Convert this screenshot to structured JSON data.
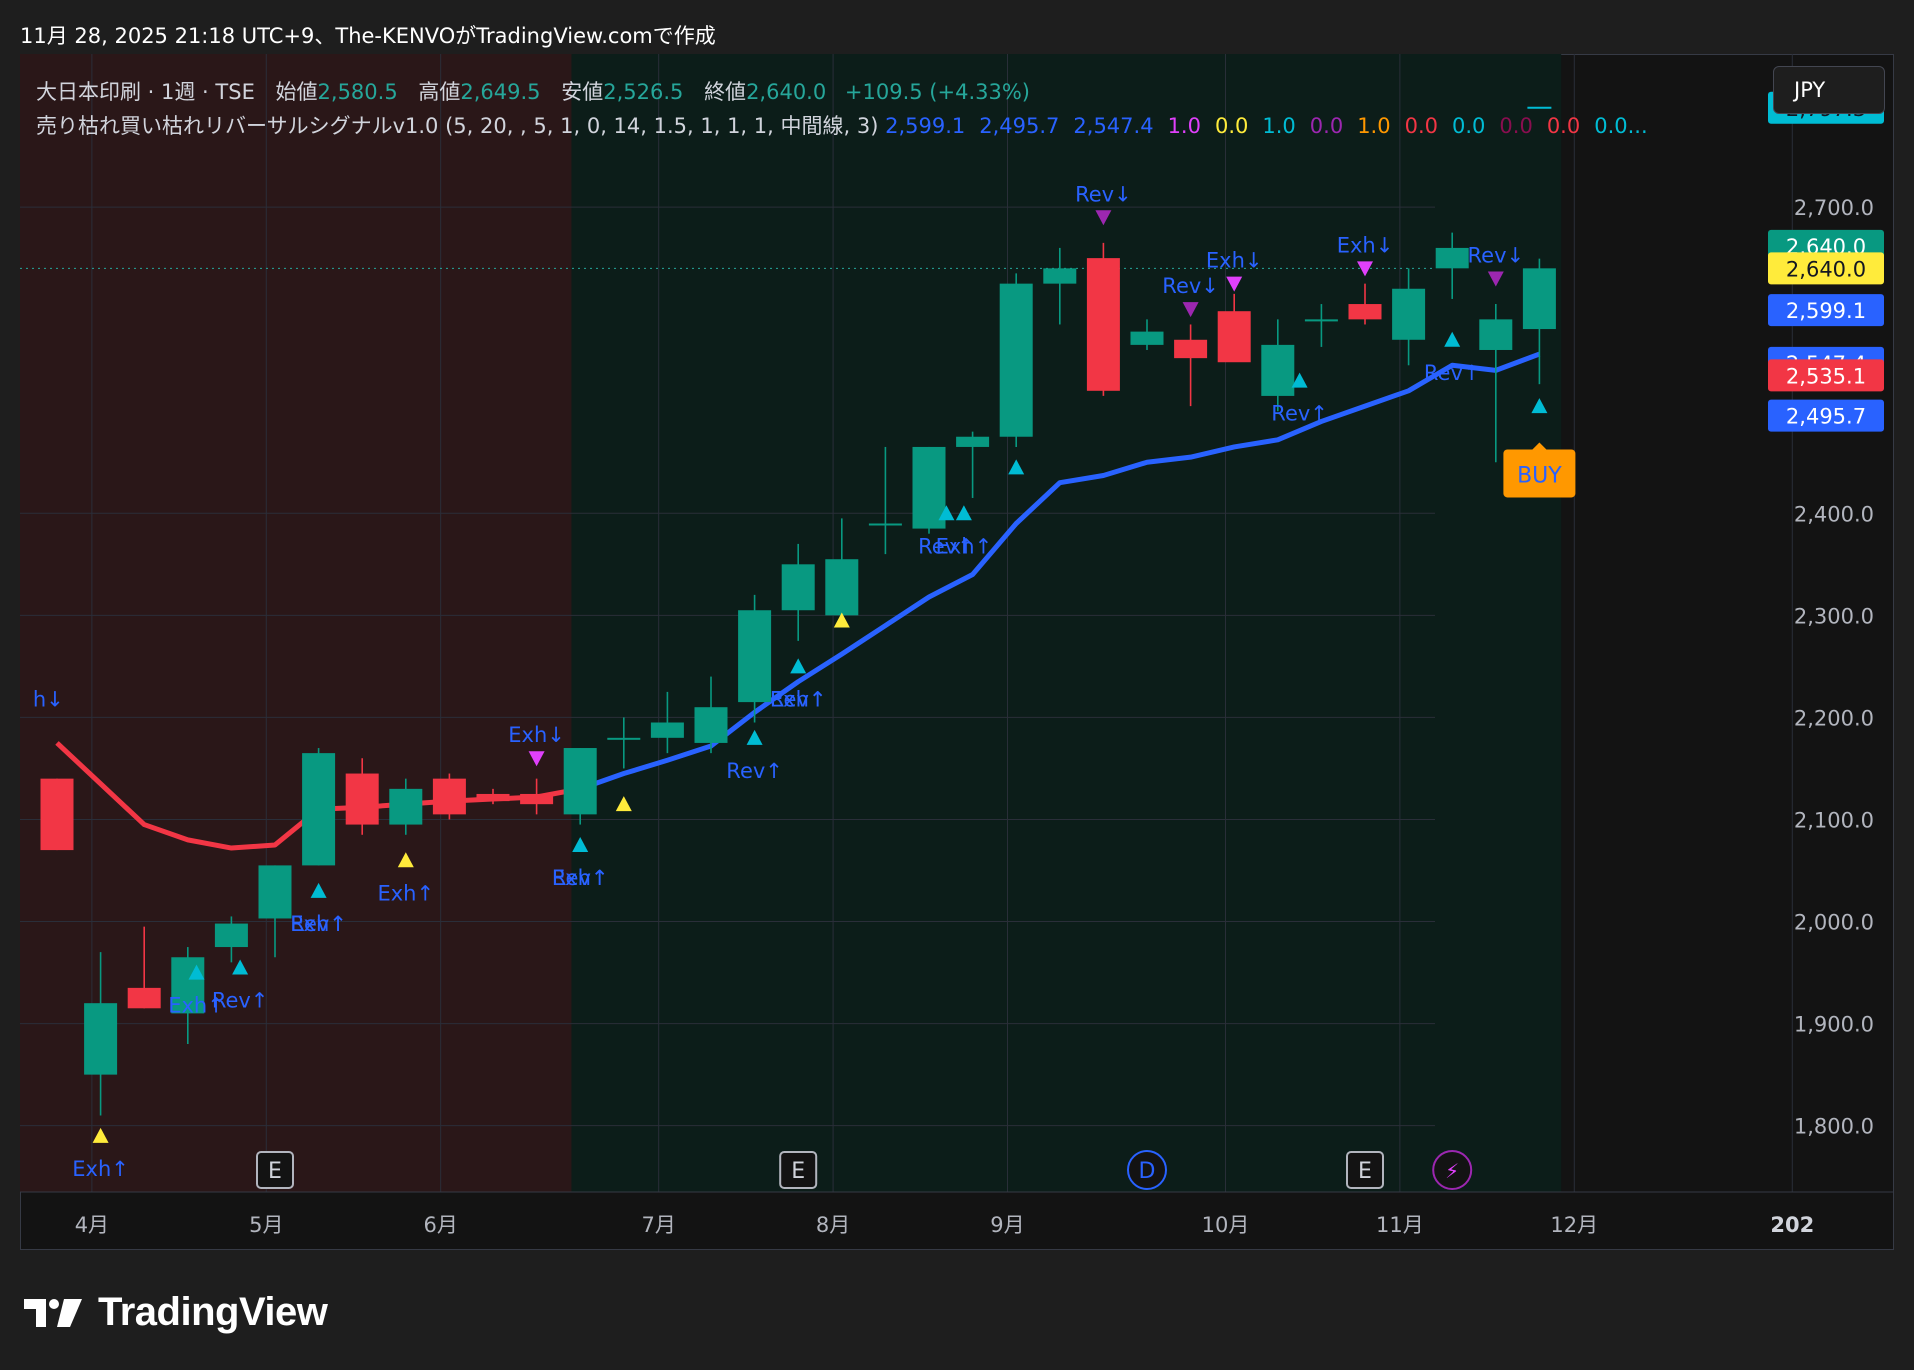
{
  "caption": "11月 28, 2025 21:18 UTC+9、The-KENVOがTradingView.comで作成",
  "currency": "JPY",
  "brand": "TradingView",
  "legend": {
    "symbol": "大日本印刷 · 1週 · TSE",
    "open_label": "始値",
    "open": "2,580.5",
    "high_label": "高値",
    "high": "2,649.5",
    "low_label": "安値",
    "low": "2,526.5",
    "close_label": "終値",
    "close": "2,640.0",
    "change": "+109.5 (+4.33%)"
  },
  "indicator": {
    "title": "売り枯れ買い枯れリバーサルシグナルv1.0 (5, 20, , 5, 1, 0, 14, 1.5, 1, 1, 1, 中間線, 3)",
    "values": [
      {
        "text": "2,599.1",
        "color": "#2962ff"
      },
      {
        "text": "2,495.7",
        "color": "#2962ff"
      },
      {
        "text": "2,547.4",
        "color": "#2962ff"
      },
      {
        "text": "1.0",
        "color": "#e040fb"
      },
      {
        "text": "0.0",
        "color": "#ffeb3b"
      },
      {
        "text": "1.0",
        "color": "#00bcd4"
      },
      {
        "text": "0.0",
        "color": "#9c27b0"
      },
      {
        "text": "1.0",
        "color": "#ff9800"
      },
      {
        "text": "0.0",
        "color": "#f23645"
      },
      {
        "text": "0.0",
        "color": "#00bcd4"
      },
      {
        "text": "0.0",
        "color": "#880e4f"
      },
      {
        "text": "0.0",
        "color": "#f23645"
      },
      {
        "text": "0.0...",
        "color": "#00bcd4"
      }
    ]
  },
  "colors": {
    "up": "#089981",
    "down": "#f23645",
    "ma_up": "#2962ff",
    "ma_down": "#f23645",
    "bg_bear": "#2a1718",
    "bg_bull": "#0c1d19",
    "signal_label": "#2962ff"
  },
  "chart_data": {
    "type": "candlestick",
    "title": "",
    "ylim": [
      1735,
      2850
    ],
    "y_ticks": [
      1800,
      1900,
      2000,
      2100,
      2200,
      2300,
      2400,
      2700
    ],
    "y_tick_labels": [
      "1,800.0",
      "1,900.0",
      "2,000.0",
      "2,100.0",
      "2,200.0",
      "2,300.0",
      "2,400.0",
      "2,700.0"
    ],
    "x_axis_labels": [
      {
        "label": "4月",
        "week": 0.8
      },
      {
        "label": "5月",
        "week": 4.8
      },
      {
        "label": "6月",
        "week": 8.8
      },
      {
        "label": "7月",
        "week": 13.8
      },
      {
        "label": "8月",
        "week": 17.8
      },
      {
        "label": "9月",
        "week": 21.8
      },
      {
        "label": "10月",
        "week": 26.8
      },
      {
        "label": "11月",
        "week": 30.8
      },
      {
        "label": "12月",
        "week": 34.8
      },
      {
        "label": "202",
        "week": 39.8
      }
    ],
    "candles": [
      {
        "w": 0,
        "o": 2140,
        "h": 2140,
        "l": 2070,
        "c": 2070
      },
      {
        "w": 1,
        "o": 1850,
        "h": 1970,
        "l": 1810,
        "c": 1920
      },
      {
        "w": 2,
        "o": 1935,
        "h": 1995,
        "l": 1915,
        "c": 1915
      },
      {
        "w": 3,
        "o": 1910,
        "h": 1975,
        "l": 1880,
        "c": 1965
      },
      {
        "w": 4,
        "o": 1975,
        "h": 2005,
        "l": 1960,
        "c": 1998
      },
      {
        "w": 5,
        "o": 2003,
        "h": 2055,
        "l": 1965,
        "c": 2055
      },
      {
        "w": 6,
        "o": 2055,
        "h": 2170,
        "l": 2055,
        "c": 2165
      },
      {
        "w": 7,
        "o": 2145,
        "h": 2160,
        "l": 2085,
        "c": 2095
      },
      {
        "w": 8,
        "o": 2095,
        "h": 2140,
        "l": 2085,
        "c": 2130
      },
      {
        "w": 9,
        "o": 2140,
        "h": 2145,
        "l": 2100,
        "c": 2105
      },
      {
        "w": 10,
        "o": 2125,
        "h": 2130,
        "l": 2115,
        "c": 2118
      },
      {
        "w": 11,
        "o": 2125,
        "h": 2140,
        "l": 2105,
        "c": 2115
      },
      {
        "w": 12,
        "o": 2105,
        "h": 2170,
        "l": 2095,
        "c": 2170
      },
      {
        "w": 13,
        "o": 2180,
        "h": 2200,
        "l": 2150,
        "c": 2180
      },
      {
        "w": 14,
        "o": 2180,
        "h": 2225,
        "l": 2165,
        "c": 2195
      },
      {
        "w": 15,
        "o": 2175,
        "h": 2240,
        "l": 2165,
        "c": 2210
      },
      {
        "w": 16,
        "o": 2215,
        "h": 2320,
        "l": 2195,
        "c": 2305
      },
      {
        "w": 17,
        "o": 2305,
        "h": 2370,
        "l": 2275,
        "c": 2350
      },
      {
        "w": 18,
        "o": 2300,
        "h": 2395,
        "l": 2290,
        "c": 2355
      },
      {
        "w": 19,
        "o": 2390,
        "h": 2465,
        "l": 2360,
        "c": 2390
      },
      {
        "w": 20,
        "o": 2385,
        "h": 2465,
        "l": 2380,
        "c": 2465
      },
      {
        "w": 21,
        "o": 2465,
        "h": 2480,
        "l": 2415,
        "c": 2475
      },
      {
        "w": 22,
        "o": 2475,
        "h": 2635,
        "l": 2465,
        "c": 2625
      },
      {
        "w": 23,
        "o": 2625,
        "h": 2660,
        "l": 2585,
        "c": 2640
      },
      {
        "w": 24,
        "o": 2650,
        "h": 2665,
        "l": 2515,
        "c": 2520
      },
      {
        "w": 25,
        "o": 2565,
        "h": 2590,
        "l": 2560,
        "c": 2578
      },
      {
        "w": 26,
        "o": 2570,
        "h": 2585,
        "l": 2505,
        "c": 2552
      },
      {
        "w": 27,
        "o": 2598,
        "h": 2615,
        "l": 2565,
        "c": 2548
      },
      {
        "w": 28,
        "o": 2515,
        "h": 2590,
        "l": 2500,
        "c": 2565
      },
      {
        "w": 29,
        "o": 2588,
        "h": 2605,
        "l": 2563,
        "c": 2590
      },
      {
        "w": 30,
        "o": 2605,
        "h": 2625,
        "l": 2585,
        "c": 2590
      },
      {
        "w": 31,
        "o": 2570,
        "h": 2640,
        "l": 2545,
        "c": 2620
      },
      {
        "w": 32,
        "o": 2640,
        "h": 2675,
        "l": 2610,
        "c": 2660
      },
      {
        "w": 33,
        "o": 2560,
        "h": 2605,
        "l": 2450,
        "c": 2590
      },
      {
        "w": 34,
        "o": 2580.5,
        "h": 2649.5,
        "l": 2526.5,
        "c": 2640
      }
    ],
    "ma_line": [
      {
        "w": 0,
        "v": 2175
      },
      {
        "w": 1,
        "v": 2135
      },
      {
        "w": 2,
        "v": 2095
      },
      {
        "w": 3,
        "v": 2080
      },
      {
        "w": 4,
        "v": 2072
      },
      {
        "w": 5,
        "v": 2075
      },
      {
        "w": 6,
        "v": 2110
      },
      {
        "w": 7,
        "v": 2112
      },
      {
        "w": 8,
        "v": 2115
      },
      {
        "w": 9,
        "v": 2118
      },
      {
        "w": 10,
        "v": 2120
      },
      {
        "w": 11,
        "v": 2122
      },
      {
        "w": 12,
        "v": 2130
      },
      {
        "w": 13,
        "v": 2145
      },
      {
        "w": 14,
        "v": 2158
      },
      {
        "w": 15,
        "v": 2172
      },
      {
        "w": 16,
        "v": 2205
      },
      {
        "w": 17,
        "v": 2235
      },
      {
        "w": 18,
        "v": 2262
      },
      {
        "w": 19,
        "v": 2290
      },
      {
        "w": 20,
        "v": 2318
      },
      {
        "w": 21,
        "v": 2340
      },
      {
        "w": 22,
        "v": 2390
      },
      {
        "w": 23,
        "v": 2430
      },
      {
        "w": 24,
        "v": 2437
      },
      {
        "w": 25,
        "v": 2450
      },
      {
        "w": 26,
        "v": 2455
      },
      {
        "w": 27,
        "v": 2465
      },
      {
        "w": 28,
        "v": 2472
      },
      {
        "w": 29,
        "v": 2490
      },
      {
        "w": 30,
        "v": 2505
      },
      {
        "w": 31,
        "v": 2520
      },
      {
        "w": 32,
        "v": 2545
      },
      {
        "w": 33,
        "v": 2540
      },
      {
        "w": 34,
        "v": 2556
      }
    ],
    "regime_shift_week": 11.8,
    "shading_end_week": 34.5,
    "last_price": 2640.0,
    "price_labels": [
      {
        "text": "2,797.3",
        "value": 2797.3,
        "bg": "#00bcd4",
        "fg": "#131722"
      },
      {
        "text": "2,640.0",
        "value": 2662,
        "bg": "#089981",
        "fg": "#ffffff"
      },
      {
        "text": "2,640.0",
        "value": 2640,
        "bg": "#ffeb3b",
        "fg": "#131722"
      },
      {
        "text": "2,599.1",
        "value": 2599.1,
        "bg": "#2962ff",
        "fg": "#ffffff"
      },
      {
        "text": "2,547.4",
        "value": 2547.4,
        "bg": "#2962ff",
        "fg": "#ffffff"
      },
      {
        "text": "2,535.1",
        "value": 2535.1,
        "bg": "#f23645",
        "fg": "#ffffff"
      },
      {
        "text": "2,495.7",
        "value": 2495.7,
        "bg": "#2962ff",
        "fg": "#ffffff"
      }
    ],
    "signals": [
      {
        "w": -0.2,
        "dir": "down",
        "text": "h↓",
        "value": 2195,
        "marker": false
      },
      {
        "w": 1,
        "dir": "up",
        "color": "#ffeb3b",
        "text": "Exh↑",
        "value": 1790
      },
      {
        "w": 3.2,
        "dir": "up",
        "color": "#00bcd4",
        "text": "Exh↑",
        "value": 1950
      },
      {
        "w": 4.2,
        "dir": "up",
        "color": "#00bcd4",
        "text": "Rev↑",
        "value": 1955
      },
      {
        "w": 6,
        "dir": "up",
        "color": "#00bcd4",
        "text": "Exh↑",
        "value": 2030
      },
      {
        "w": 6,
        "dir": "up",
        "text": "Rev↑",
        "value": 2030,
        "marker": false
      },
      {
        "w": 8,
        "dir": "up",
        "color": "#ffeb3b",
        "text": "Exh↑",
        "value": 2060
      },
      {
        "w": 11,
        "dir": "down",
        "color": "#e040fb",
        "text": "Exh↓",
        "value": 2160
      },
      {
        "w": 12,
        "dir": "up",
        "color": "#00bcd4",
        "text": "Exh↑",
        "value": 2075
      },
      {
        "w": 12,
        "dir": "up",
        "text": "Rev↑",
        "value": 2075,
        "marker": false
      },
      {
        "w": 13,
        "dir": "up",
        "color": "#ffeb3b",
        "text": "",
        "value": 2115
      },
      {
        "w": 16,
        "dir": "up",
        "color": "#00bcd4",
        "text": "Rev↑",
        "value": 2180
      },
      {
        "w": 17,
        "dir": "up",
        "color": "#00bcd4",
        "text": "Exh↑",
        "value": 2250
      },
      {
        "w": 17,
        "dir": "up",
        "text": "Rev↑",
        "value": 2250,
        "marker": false
      },
      {
        "w": 18,
        "dir": "up",
        "color": "#ffeb3b",
        "text": "",
        "value": 2295
      },
      {
        "w": 20.4,
        "dir": "up",
        "color": "#00bcd4",
        "text": "Rev↑",
        "value": 2400
      },
      {
        "w": 20.8,
        "dir": "up",
        "color": "#00bcd4",
        "text": "Exh↑",
        "value": 2400
      },
      {
        "w": 22,
        "dir": "up",
        "color": "#00bcd4",
        "text": "",
        "value": 2445
      },
      {
        "w": 24,
        "dir": "down",
        "color": "#9c27b0",
        "text": "Rev↓",
        "value": 2690
      },
      {
        "w": 26,
        "dir": "down",
        "color": "#9c27b0",
        "text": "Rev↓",
        "value": 2600
      },
      {
        "w": 27,
        "dir": "down",
        "color": "#e040fb",
        "text": "Exh↓",
        "value": 2625
      },
      {
        "w": 28.5,
        "dir": "up",
        "color": "#00bcd4",
        "text": "Rev↑",
        "value": 2530
      },
      {
        "w": 30,
        "dir": "down",
        "color": "#e040fb",
        "text": "Exh↓",
        "value": 2640
      },
      {
        "w": 32,
        "dir": "up",
        "color": "#00bcd4",
        "text": "Rev↑",
        "value": 2570
      },
      {
        "w": 33,
        "dir": "down",
        "color": "#9c27b0",
        "text": "Rev↓",
        "value": 2630
      },
      {
        "w": 34,
        "dir": "up",
        "color": "#00bcd4",
        "text": "",
        "value": 2505
      }
    ],
    "buy_label": {
      "w": 34,
      "text": "BUY",
      "value": 2440
    },
    "events": [
      {
        "w": 5,
        "letter": "E",
        "kind": "earnings"
      },
      {
        "w": 17,
        "letter": "E",
        "kind": "earnings"
      },
      {
        "w": 25,
        "letter": "D",
        "kind": "dividend"
      },
      {
        "w": 30,
        "letter": "E",
        "kind": "earnings"
      },
      {
        "w": 32,
        "letter": "⚡",
        "kind": "split"
      }
    ]
  }
}
